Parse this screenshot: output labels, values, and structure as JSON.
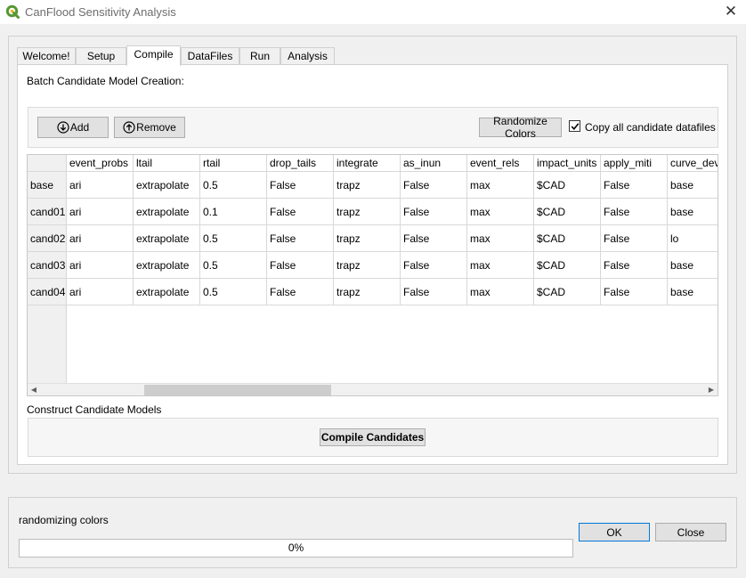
{
  "window": {
    "title": "CanFlood Sensitivity Analysis",
    "close_glyph": "✕",
    "app_icon": "qgis-icon"
  },
  "tabs": [
    {
      "label": "Welcome!",
      "active": false
    },
    {
      "label": "Setup",
      "active": false
    },
    {
      "label": "Compile",
      "active": true
    },
    {
      "label": "DataFiles",
      "active": false
    },
    {
      "label": "Run",
      "active": false
    },
    {
      "label": "Analysis",
      "active": false
    }
  ],
  "compile_tab": {
    "section_title": "Batch Candidate Model Creation:",
    "add_button": "Add",
    "add_icon": "arrow-down-circle-icon",
    "remove_button": "Remove",
    "remove_icon": "arrow-up-circle-icon",
    "randomize_button": "Randomize Colors",
    "copy_checkbox": {
      "label": "Copy all candidate datafiles",
      "checked": true
    },
    "construct_label": "Construct Candidate Models",
    "compile_button": "Compile Candidates"
  },
  "table": {
    "columns": [
      "event_probs",
      "ltail",
      "rtail",
      "drop_tails",
      "integrate",
      "as_inun",
      "event_rels",
      "impact_units",
      "apply_miti",
      "curve_dev"
    ],
    "rows": [
      {
        "name": "base",
        "cells": [
          "ari",
          "extrapolate",
          "0.5",
          "False",
          "trapz",
          "False",
          "max",
          "$CAD",
          "False",
          "base"
        ]
      },
      {
        "name": "cand01",
        "cells": [
          "ari",
          "extrapolate",
          "0.1",
          "False",
          "trapz",
          "False",
          "max",
          "$CAD",
          "False",
          "base"
        ]
      },
      {
        "name": "cand02",
        "cells": [
          "ari",
          "extrapolate",
          "0.5",
          "False",
          "trapz",
          "False",
          "max",
          "$CAD",
          "False",
          "lo"
        ]
      },
      {
        "name": "cand03",
        "cells": [
          "ari",
          "extrapolate",
          "0.5",
          "False",
          "trapz",
          "False",
          "max",
          "$CAD",
          "False",
          "base"
        ]
      },
      {
        "name": "cand04",
        "cells": [
          "ari",
          "extrapolate",
          "0.5",
          "False",
          "trapz",
          "False",
          "max",
          "$CAD",
          "False",
          "base"
        ]
      }
    ],
    "scroll_left_glyph": "◀",
    "scroll_right_glyph": "▶"
  },
  "footer": {
    "status_text": "randomizing colors",
    "progress_percent": 0,
    "progress_label": "0%",
    "ok_button": "OK",
    "close_button": "Close"
  },
  "colors": {
    "focus_border": "#0078d7",
    "qgis_green": "#589632",
    "qgis_yellow": "#f0b400"
  }
}
